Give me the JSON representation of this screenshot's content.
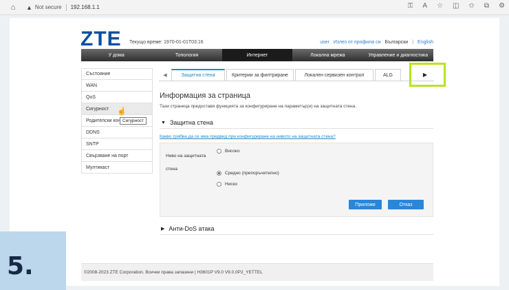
{
  "browser": {
    "not_secure": "Not secure",
    "address": "192.168.1.1"
  },
  "header": {
    "logo": "ZTE",
    "system_time": "Текущо време: 1970-01-01T03:16",
    "user": "user",
    "logout": "Излез от профила си",
    "lang_bg": "Български",
    "lang_sep": "|",
    "lang_en": "English"
  },
  "menu": [
    {
      "label": "У дома"
    },
    {
      "label": "Топология"
    },
    {
      "label": "Интернет",
      "active": true
    },
    {
      "label": "Локална мрежа"
    },
    {
      "label": "Управление и диагностика"
    }
  ],
  "sidebar": {
    "items": [
      {
        "label": "Състояние"
      },
      {
        "label": "WAN"
      },
      {
        "label": "QoS"
      },
      {
        "label": "Сигурност",
        "active": true
      },
      {
        "label": "Родителски контрол"
      },
      {
        "label": "DDNS"
      },
      {
        "label": "SNTP"
      },
      {
        "label": "Свързване на порт"
      },
      {
        "label": "Мултикаст"
      }
    ],
    "tooltip": "Сигурност"
  },
  "tabs": [
    {
      "label": "Защитна стена",
      "active": true
    },
    {
      "label": "Критерии за филтриране"
    },
    {
      "label": "Локален сервизен контрол"
    },
    {
      "label": "ALG"
    }
  ],
  "content": {
    "title": "Информация за страница",
    "description": "Тази страница предоставя функцията за конфигуриране на параметър(и) на защитната стена.",
    "section_firewall": "Защитна стена",
    "help_link": "Какво трябва да се има предвид при конфигуриране на нивото на защитната стена?",
    "level_label_1": "Ниво на защитната",
    "level_label_2": "стена",
    "options": [
      {
        "label": "Високо",
        "selected": false
      },
      {
        "label": "Средно (препоръчително)",
        "selected": true
      },
      {
        "label": "Ниско",
        "selected": false
      }
    ],
    "apply": "Приложи",
    "cancel": "Отказ",
    "section_dos": "Анти-DoS атака"
  },
  "footer": {
    "text": "©2008-2023 ZTE Corporation. Всички права запазени  |   H3601P V9.0 V9.0.0P2_YETTEL"
  },
  "step": "5."
}
